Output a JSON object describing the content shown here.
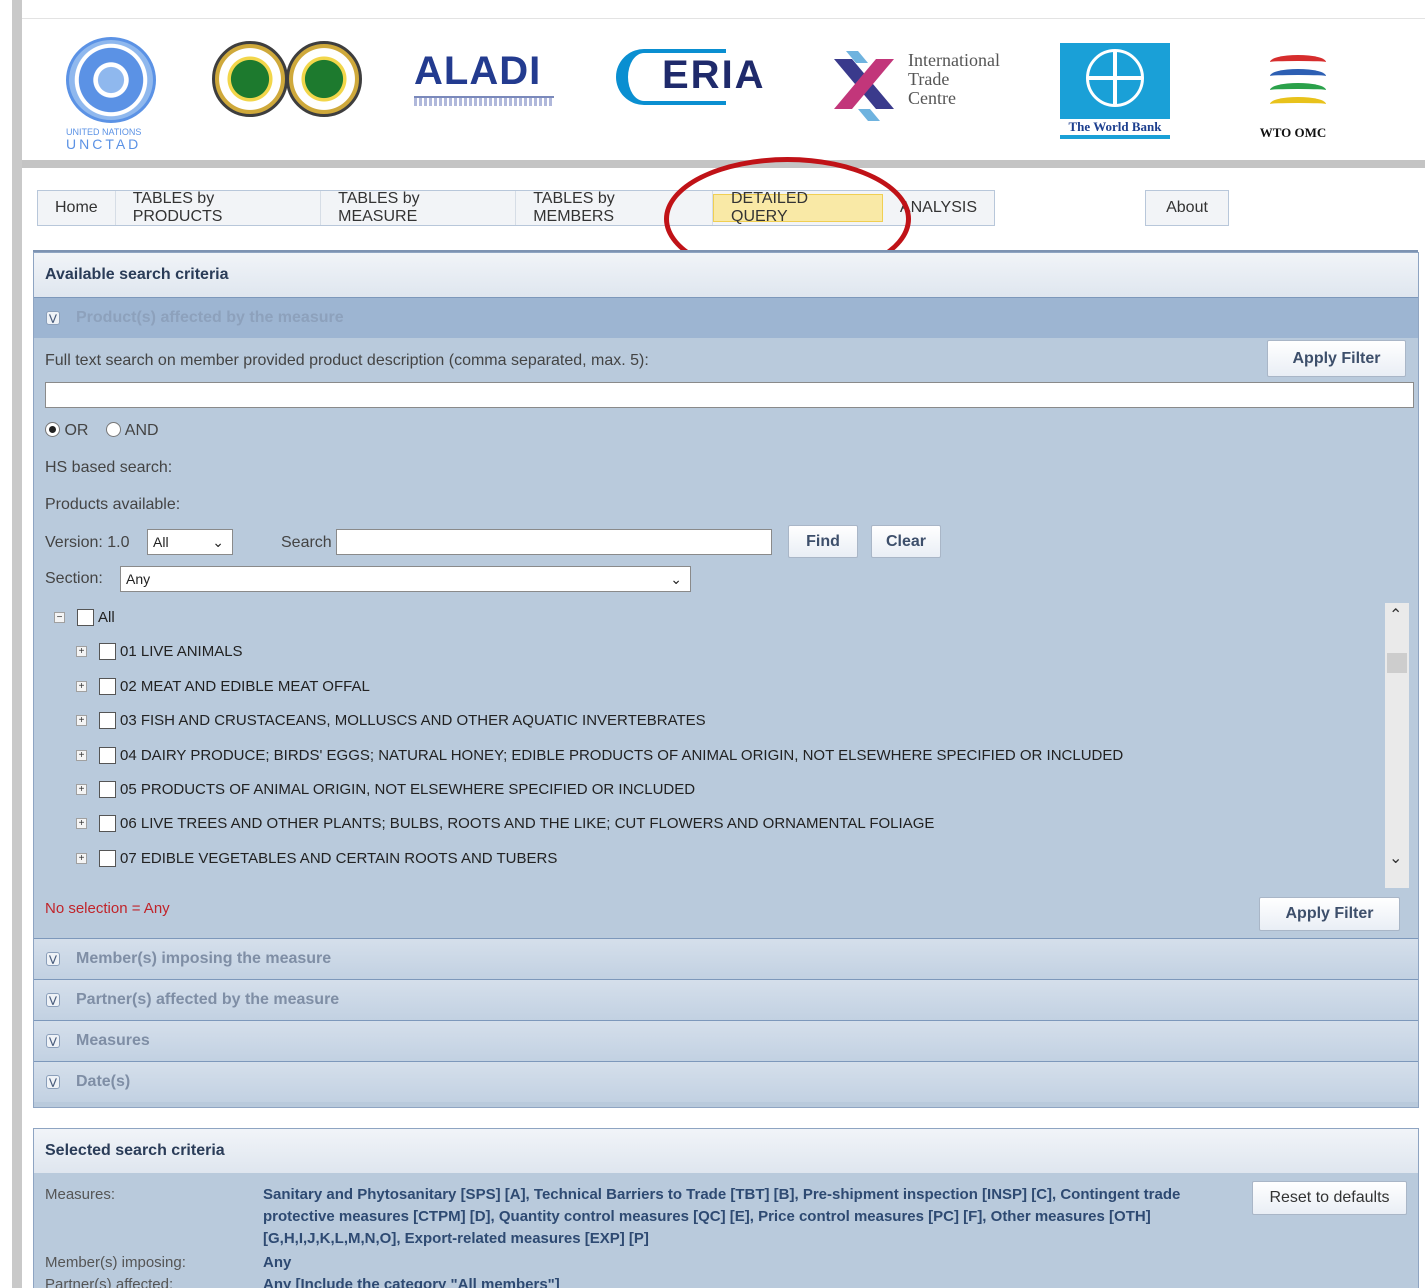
{
  "logos": {
    "un_line1": "UNITED NATIONS",
    "un_line2": "UNCTAD",
    "aladi": "ALADI",
    "eria": "ERIA",
    "itc": "International Trade Centre",
    "itc_line1": "International",
    "itc_line2": "Trade",
    "itc_line3": "Centre",
    "worldbank": "The World Bank",
    "wto": "WTO OMC"
  },
  "nav": {
    "items": [
      "Home",
      "TABLES by PRODUCTS",
      "TABLES by MEASURE",
      "TABLES by MEMBERS",
      "DETAILED QUERY",
      "ANALYSIS"
    ],
    "active": "DETAILED QUERY",
    "about": "About"
  },
  "available": {
    "title": "Available search criteria",
    "products_section": "Product(s) affected by the measure",
    "fulltext_label": "Full text search on member provided product description (comma separated, max. 5):",
    "apply_filter": "Apply Filter",
    "fulltext_value": "",
    "or_label": "OR",
    "and_label": "AND",
    "selected_logic": "OR",
    "hs_label": "HS based search:",
    "products_available": "Products available:",
    "version_label": "Version: 1.0",
    "version_value": "All",
    "search_label": "Search",
    "search_value": "",
    "find": "Find",
    "clear": "Clear",
    "section_label": "Section:",
    "section_value": "Any",
    "tree_all": "All",
    "tree_items": [
      "01 LIVE ANIMALS",
      "02 MEAT AND EDIBLE MEAT OFFAL",
      "03 FISH AND CRUSTACEANS, MOLLUSCS AND OTHER AQUATIC INVERTEBRATES",
      "04 DAIRY PRODUCE; BIRDS' EGGS; NATURAL HONEY; EDIBLE PRODUCTS OF ANIMAL ORIGIN, NOT ELSEWHERE SPECIFIED OR INCLUDED",
      "05 PRODUCTS OF ANIMAL ORIGIN, NOT ELSEWHERE SPECIFIED OR INCLUDED",
      "06 LIVE TREES AND OTHER PLANTS; BULBS, ROOTS AND THE LIKE; CUT FLOWERS AND ORNAMENTAL FOLIAGE",
      "07 EDIBLE VEGETABLES AND CERTAIN ROOTS AND TUBERS"
    ],
    "no_selection": "No selection = Any",
    "collapsed_sections": [
      "Member(s) imposing the measure",
      "Partner(s) affected by the measure",
      "Measures",
      "Date(s)"
    ]
  },
  "selected": {
    "title": "Selected search criteria",
    "reset": "Reset to defaults",
    "measures_label": "Measures:",
    "measures_value": "Sanitary and Phytosanitary [SPS] [A], Technical Barriers to Trade [TBT] [B], Pre-shipment inspection [INSP] [C], Contingent trade protective measures [CTPM] [D], Quantity control measures [QC] [E], Price control measures [PC] [F], Other measures [OTH] [G,H,I,J,K,L,M,N,O], Export-related measures [EXP] [P]",
    "imposing_label": "Member(s) imposing:",
    "imposing_value": "Any",
    "partner_label": "Partner(s) affected:",
    "partner_value": "Any [Include the category \"All members\"]"
  },
  "colors": {
    "panel": "#b9cadc",
    "highlight_ring": "#c01217",
    "active_tab": "#f9e9a6",
    "no_selection_text": "#c0242a"
  }
}
